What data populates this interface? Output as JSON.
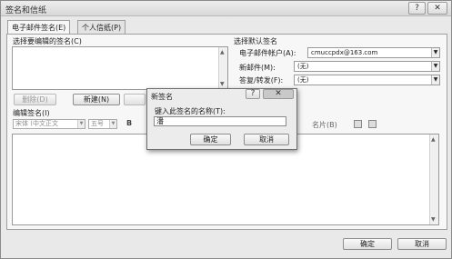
{
  "window": {
    "title": "签名和信纸",
    "help_label": "?",
    "close_label": "✕"
  },
  "tabs": [
    {
      "label": "电子邮件签名(E)"
    },
    {
      "label": "个人信纸(P)"
    }
  ],
  "left": {
    "select_label": "选择要编辑的签名(C)",
    "delete_label": "删除(D)",
    "new_label": "新建(N)",
    "edit_label": "编辑签名(I)",
    "font_name": "宋体 (中文正文",
    "font_size": "五号",
    "bold_label": "B",
    "card_label": "名片(B)"
  },
  "default_sig": {
    "heading": "选择默认签名",
    "account_label": "电子邮件帐户(A):",
    "account_value": "cmuccpdx@163.com",
    "new_msg_label": "新邮件(M):",
    "new_msg_value": "(无)",
    "reply_label": "答复/转发(F):",
    "reply_value": "(无)"
  },
  "dialog": {
    "ok_label": "确定",
    "cancel_label": "取消"
  },
  "popup": {
    "title": "新签名",
    "help_label": "?",
    "close_label": "✕",
    "prompt": "键入此签名的名称(T):",
    "input_value": "潘",
    "ok_label": "确定",
    "cancel_label": "取消"
  }
}
